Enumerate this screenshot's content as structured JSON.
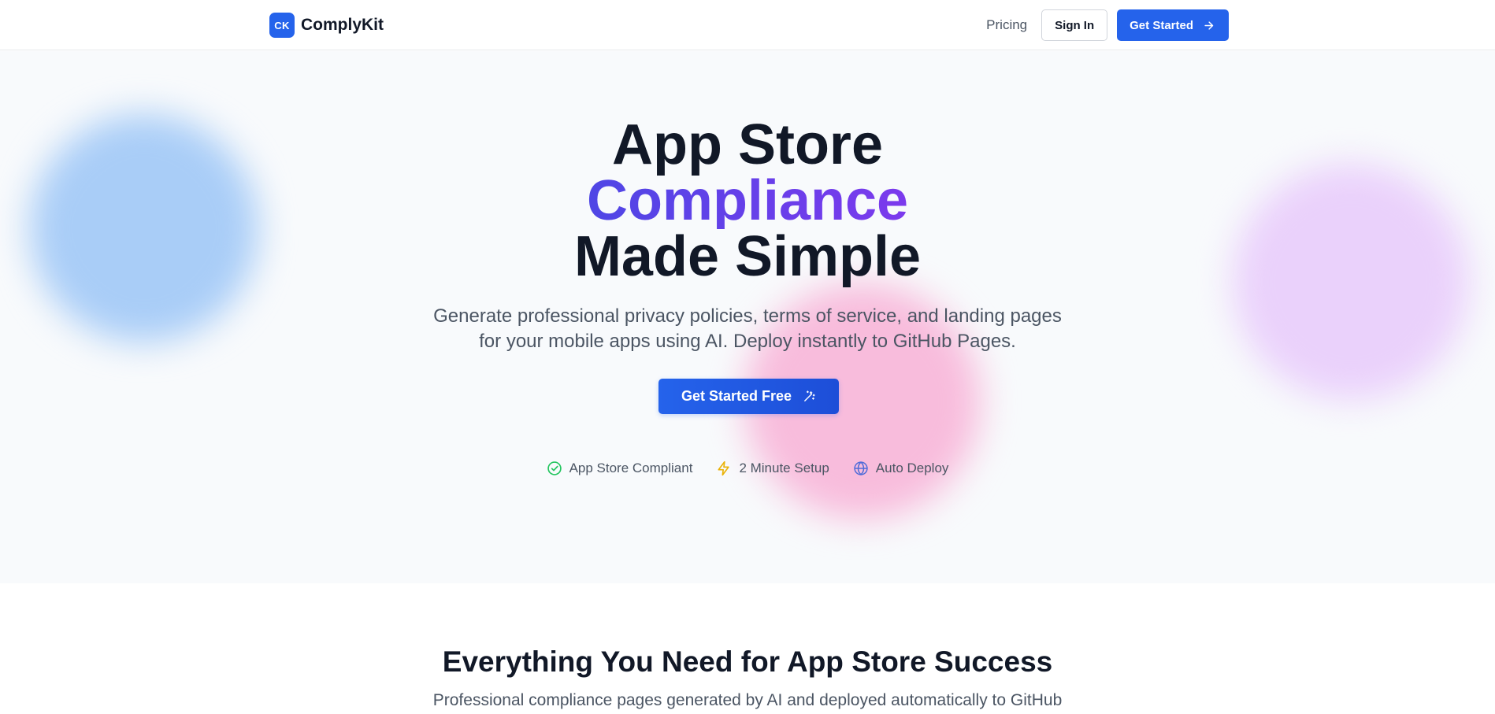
{
  "header": {
    "logo_text": "CK",
    "brand_name": "ComplyKit",
    "nav_pricing": "Pricing",
    "signin_label": "Sign In",
    "get_started_label": "Get Started"
  },
  "hero": {
    "title_line1": "App Store",
    "title_line2": "Compliance",
    "title_line3": "Made Simple",
    "subtitle": "Generate professional privacy policies, terms of service, and landing pages for your mobile apps using AI. Deploy instantly to GitHub Pages.",
    "cta_label": "Get Started Free",
    "features": [
      {
        "label": "App Store Compliant",
        "icon": "check-circle-icon"
      },
      {
        "label": "2 Minute Setup",
        "icon": "lightning-icon"
      },
      {
        "label": "Auto Deploy",
        "icon": "globe-icon"
      }
    ]
  },
  "section": {
    "title": "Everything You Need for App Store Success",
    "subtitle": "Professional compliance pages generated by AI and deployed automatically to GitHub"
  },
  "colors": {
    "primary": "#2563eb",
    "accent_gradient_start": "#4f46e5",
    "accent_gradient_end": "#7c3aed",
    "success": "#22c55e",
    "warning": "#eab308"
  }
}
